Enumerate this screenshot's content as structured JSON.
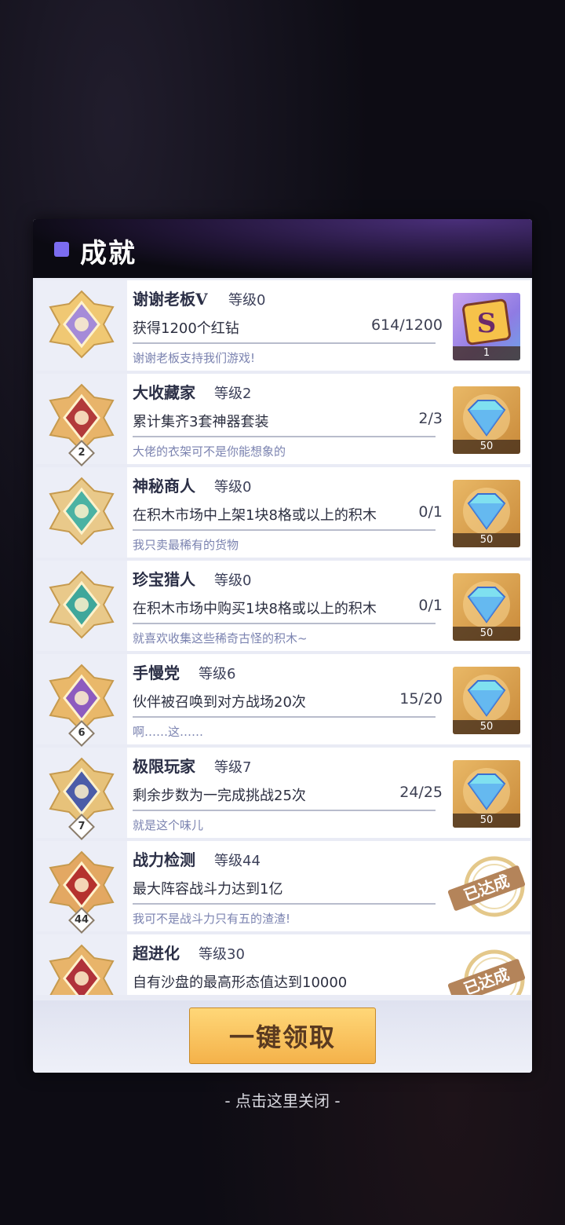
{
  "panel": {
    "title": "成就"
  },
  "achievements": [
    {
      "name": "谢谢老板V",
      "level_label": "等级0",
      "task": "获得1200个红钻",
      "progress": "614/1200",
      "desc": "谢谢老板支持我们游戏!",
      "badge_level": "",
      "reward_type": "card",
      "reward_qty": "1",
      "completed": false
    },
    {
      "name": "大收藏家",
      "level_label": "等级2",
      "task": "累计集齐3套神器套装",
      "progress": "2/3",
      "desc": "大佬的衣架可不是你能想象的",
      "badge_level": "2",
      "reward_type": "diamond",
      "reward_qty": "50",
      "completed": false
    },
    {
      "name": "神秘商人",
      "level_label": "等级0",
      "task": "在积木市场中上架1块8格或以上的积木",
      "progress": "0/1",
      "desc": "我只卖最稀有的货物",
      "badge_level": "",
      "reward_type": "diamond",
      "reward_qty": "50",
      "completed": false
    },
    {
      "name": "珍宝猎人",
      "level_label": "等级0",
      "task": "在积木市场中购买1块8格或以上的积木",
      "progress": "0/1",
      "desc": "就喜欢收集这些稀奇古怪的积木~",
      "badge_level": "",
      "reward_type": "diamond",
      "reward_qty": "50",
      "completed": false
    },
    {
      "name": "手慢党",
      "level_label": "等级6",
      "task": "伙伴被召唤到对方战场20次",
      "progress": "15/20",
      "desc": "啊……这……",
      "badge_level": "6",
      "reward_type": "diamond",
      "reward_qty": "50",
      "completed": false
    },
    {
      "name": "极限玩家",
      "level_label": "等级7",
      "task": "剩余步数为一完成挑战25次",
      "progress": "24/25",
      "desc": "就是这个味儿",
      "badge_level": "7",
      "reward_type": "diamond",
      "reward_qty": "50",
      "completed": false
    },
    {
      "name": "战力检测",
      "level_label": "等级44",
      "task": "最大阵容战斗力达到1亿",
      "progress": "",
      "desc": "我可不是战斗力只有五的渣渣!",
      "badge_level": "44",
      "reward_type": "stamp",
      "reward_qty": "",
      "completed": true,
      "stamp_text": "已达成"
    },
    {
      "name": "超进化",
      "level_label": "等级30",
      "task": "自有沙盘的最高形态值达到10000",
      "progress": "",
      "desc": "",
      "badge_level": "",
      "reward_type": "stamp",
      "reward_qty": "",
      "completed": true,
      "stamp_text": "已达成"
    }
  ],
  "footer": {
    "claim_all_label": "一键领取"
  },
  "close_hint": "- 点击这里关闭 -",
  "colors": {
    "accent": "#7b6cf0",
    "button": "#f4b24a",
    "desc_text": "#7b83b0"
  },
  "icons": [
    "badge-icon",
    "diamond-icon",
    "card-icon",
    "completed-stamp-icon"
  ]
}
